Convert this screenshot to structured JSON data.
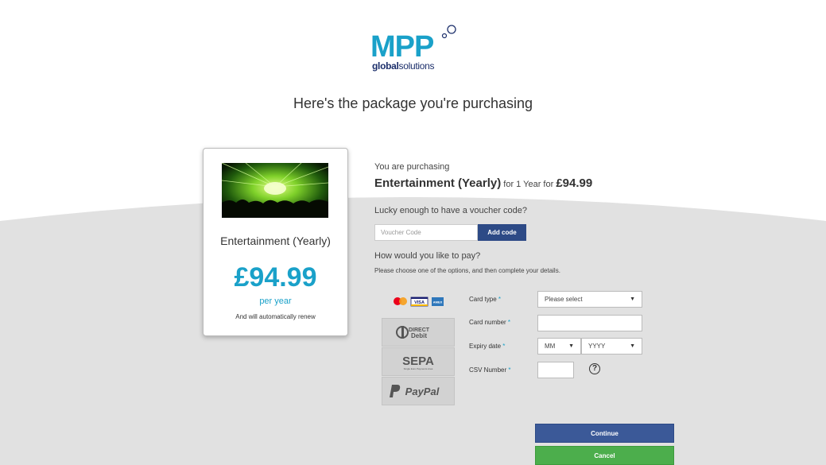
{
  "brand": {
    "name": "MPP",
    "tagline_bold": "global",
    "tagline_rest": "solutions",
    "color": "#1aa1c9",
    "navy": "#1c2f6b"
  },
  "page": {
    "title": "Here's the package you're purchasing"
  },
  "package_card": {
    "image": "concert-image",
    "name": "Entertainment (Yearly)",
    "price": "£94.99",
    "period": "per year",
    "renewal_note": "And will automatically renew"
  },
  "summary": {
    "label": "You are purchasing",
    "package_name": "Entertainment (Yearly)",
    "duration_text": " for 1 Year for ",
    "price": "£94.99"
  },
  "voucher": {
    "question": "Lucky enough to have a voucher code?",
    "placeholder": "Voucher Code",
    "button_label": "Add code"
  },
  "payment": {
    "question": "How would you like to pay?",
    "instructions": "Please choose one of the options, and then complete your details.",
    "methods": [
      {
        "id": "cards",
        "icons": [
          "mastercard-icon",
          "visa-icon",
          "amex-icon"
        ],
        "selected": true
      },
      {
        "id": "direct-debit",
        "label_top": "DIRECT",
        "label_bottom": "Debit"
      },
      {
        "id": "sepa",
        "label": "SEPA",
        "sub": "Single Euro Payments Area"
      },
      {
        "id": "paypal",
        "label": "PayPal"
      }
    ],
    "form": {
      "card_type_label": "Card type",
      "card_type_value": "Please select",
      "card_number_label": "Card number",
      "expiry_label": "Expiry date",
      "expiry_month": "MM",
      "expiry_year": "YYYY",
      "csv_label": "CSV Number",
      "required_marker": "*",
      "help_symbol": "?"
    }
  },
  "actions": {
    "continue_label": "Continue",
    "cancel_label": "Cancel"
  },
  "colors": {
    "continue": "#3b5998",
    "cancel": "#4cae4c",
    "voucher_button": "#2d4a86",
    "background_lower": "#e1e1e1"
  }
}
